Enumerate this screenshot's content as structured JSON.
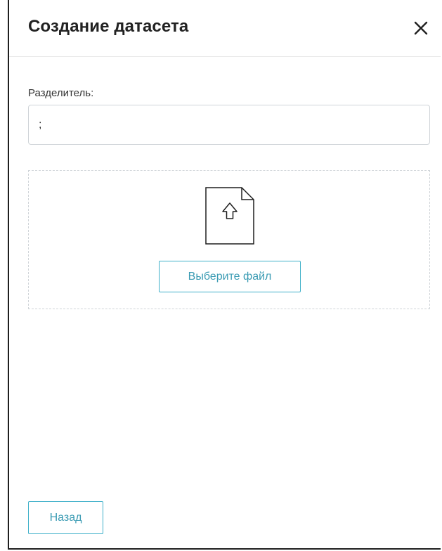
{
  "dialog": {
    "title": "Создание датасета",
    "close_icon": "close-icon"
  },
  "separator": {
    "label": "Разделитель:",
    "value": ";"
  },
  "upload": {
    "icon": "file-upload-icon",
    "button_label": "Выберите файл"
  },
  "footer": {
    "back_label": "Назад"
  },
  "colors": {
    "accent": "#3fb0c9",
    "accent_text": "#3a9bb3",
    "border": "#cfd4d8"
  }
}
